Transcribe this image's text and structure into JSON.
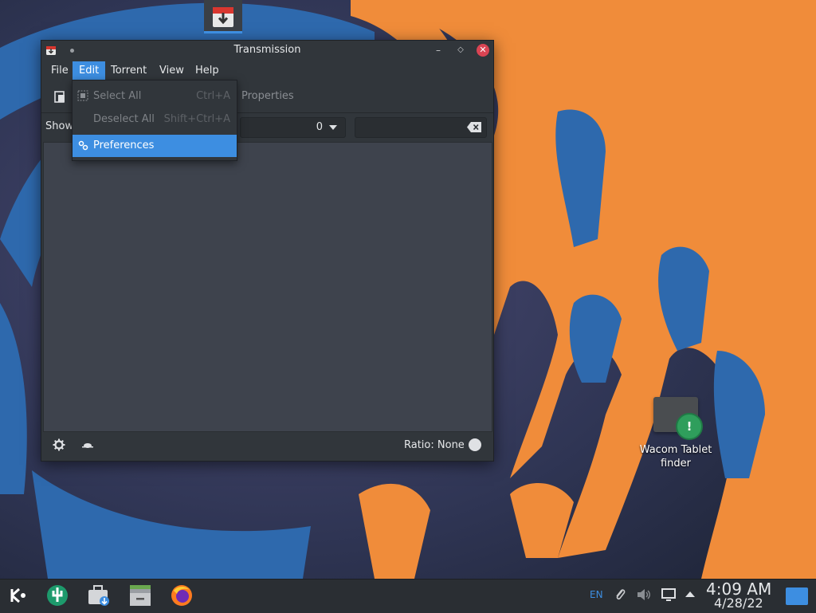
{
  "window": {
    "title": "Transmission",
    "menu": [
      "File",
      "Edit",
      "Torrent",
      "View",
      "Help"
    ],
    "active_menu": "Edit",
    "toolbar_properties_label": "Properties",
    "filter_show_label": "Show",
    "filter_count": "0",
    "search_value": "",
    "status_ratio": "Ratio: None"
  },
  "edit_menu": {
    "items": [
      {
        "label": "Select All",
        "shortcut": "Ctrl+A",
        "enabled": false
      },
      {
        "label": "Deselect All",
        "shortcut": "Shift+Ctrl+A",
        "enabled": false
      },
      {
        "label": "Preferences",
        "shortcut": "",
        "enabled": true,
        "highlighted": true
      }
    ]
  },
  "desktop": {
    "icon_label_line1": "Wacom Tablet",
    "icon_label_line2": "finder"
  },
  "taskbar": {
    "keyboard_layout": "EN",
    "time": "4:09 AM",
    "date": "4/28/22"
  },
  "colors": {
    "accent": "#3d8ee1",
    "window_bg": "#31363b",
    "list_bg": "#3e434d",
    "close_button": "#da4453",
    "wallpaper_orange": "#f08c3a",
    "wallpaper_blue": "#2f6db0"
  }
}
